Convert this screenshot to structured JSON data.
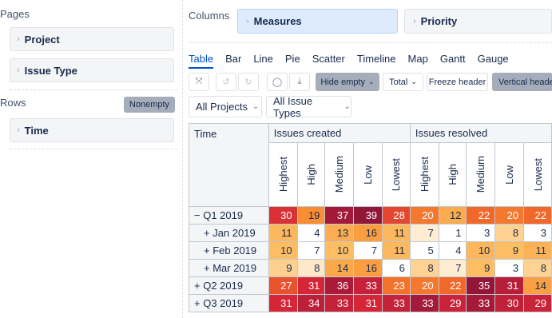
{
  "left": {
    "pages_label": "Pages",
    "pages_items": [
      "Project",
      "Issue Type"
    ],
    "rows_label": "Rows",
    "nonempty_label": "Nonempty",
    "rows_items": [
      "Time"
    ]
  },
  "columns": {
    "label": "Columns",
    "items": [
      "Measures",
      "Priority"
    ]
  },
  "tabs": [
    "Table",
    "Bar",
    "Line",
    "Pie",
    "Scatter",
    "Timeline",
    "Map",
    "Gantt",
    "Gauge"
  ],
  "active_tab": "Table",
  "toolbar": {
    "hide_empty": "Hide empty",
    "total": "Total",
    "freeze_header": "Freeze header",
    "vertical_header": "Vertical header"
  },
  "filters": {
    "projects": "All Projects",
    "issue_types": "All Issue Types"
  },
  "table": {
    "corner": "Time",
    "groups": [
      "Issues created",
      "Issues resolved"
    ],
    "priorities": [
      "Highest",
      "High",
      "Medium",
      "Low",
      "Lowest"
    ],
    "rows": [
      {
        "label": "− Q1 2019",
        "indent": false,
        "created": [
          30,
          19,
          37,
          39,
          28
        ],
        "resolved": [
          20,
          12,
          22,
          20,
          22
        ]
      },
      {
        "label": "+ Jan 2019",
        "indent": true,
        "created": [
          11,
          4,
          13,
          16,
          11
        ],
        "resolved": [
          7,
          1,
          3,
          8,
          3
        ]
      },
      {
        "label": "+ Feb 2019",
        "indent": true,
        "created": [
          10,
          7,
          10,
          7,
          11
        ],
        "resolved": [
          5,
          4,
          10,
          9,
          11
        ]
      },
      {
        "label": "+ Mar 2019",
        "indent": true,
        "created": [
          9,
          8,
          14,
          16,
          6
        ],
        "resolved": [
          8,
          7,
          9,
          3,
          8
        ]
      },
      {
        "label": "+ Q2 2019",
        "indent": false,
        "created": [
          27,
          31,
          36,
          33,
          23
        ],
        "resolved": [
          20,
          22,
          35,
          31,
          14
        ]
      },
      {
        "label": "+ Q3 2019",
        "indent": false,
        "created": [
          31,
          34,
          33,
          31,
          33
        ],
        "resolved": [
          33,
          29,
          33,
          30,
          29
        ]
      }
    ]
  },
  "colors": {
    "accent": "#0052cc",
    "active_pill": "#deebff",
    "heat_low": "#ffffff",
    "heat_high": "#8b1a3a"
  }
}
